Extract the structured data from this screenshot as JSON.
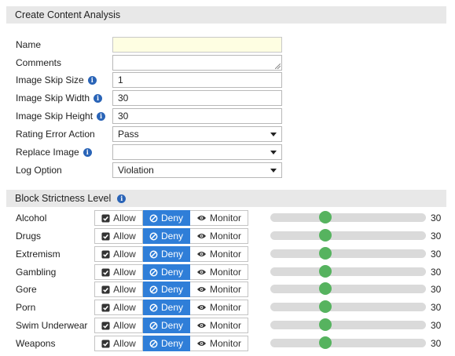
{
  "form": {
    "title": "Create Content Analysis",
    "name": {
      "label": "Name",
      "value": ""
    },
    "comments": {
      "label": "Comments",
      "value": ""
    },
    "image_skip_size": {
      "label": "Image Skip Size",
      "value": "1"
    },
    "image_skip_width": {
      "label": "Image Skip Width",
      "value": "30"
    },
    "image_skip_height": {
      "label": "Image Skip Height",
      "value": "30"
    },
    "rating_error_action": {
      "label": "Rating Error Action",
      "value": "Pass"
    },
    "replace_image": {
      "label": "Replace Image",
      "value": ""
    },
    "log_option": {
      "label": "Log Option",
      "value": "Violation"
    }
  },
  "strictness": {
    "title": "Block Strictness Level",
    "buttons": {
      "allow": "Allow",
      "deny": "Deny",
      "monitor": "Monitor"
    },
    "rows": [
      {
        "category": "Alcohol",
        "selected": "deny",
        "level": 30
      },
      {
        "category": "Drugs",
        "selected": "deny",
        "level": 30
      },
      {
        "category": "Extremism",
        "selected": "deny",
        "level": 30
      },
      {
        "category": "Gambling",
        "selected": "deny",
        "level": 30
      },
      {
        "category": "Gore",
        "selected": "deny",
        "level": 30
      },
      {
        "category": "Porn",
        "selected": "deny",
        "level": 30
      },
      {
        "category": "Swim Underwear",
        "selected": "deny",
        "level": 30
      },
      {
        "category": "Weapons",
        "selected": "deny",
        "level": 30
      }
    ],
    "slider_max": 100
  },
  "colors": {
    "accent": "#2f7ed8",
    "slider_thumb": "#56b35f",
    "info_icon": "#2a64b7"
  }
}
